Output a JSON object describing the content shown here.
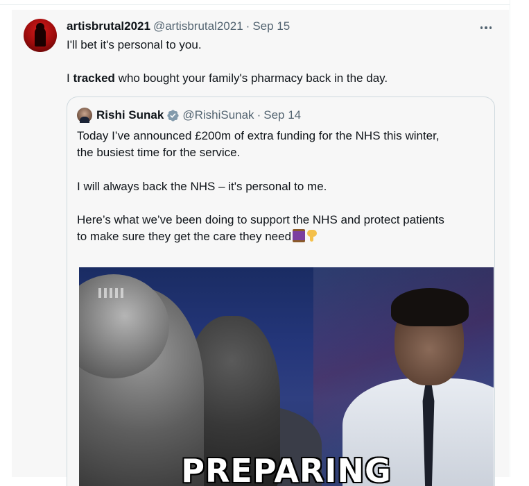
{
  "tweet": {
    "display_name": "artisbrutal2021",
    "handle": "@artisbrutal2021",
    "separator": "·",
    "date": "Sep 15",
    "line1": "I'll bet it's personal to you.",
    "line2_prefix": "I ",
    "line2_bold": "tracked",
    "line2_suffix": " who bought your family's pharmacy back in the day."
  },
  "quote": {
    "display_name": "Rishi Sunak",
    "handle": "@RishiSunak",
    "separator": "·",
    "date": "Sep 14",
    "verified": true,
    "lines": [
      "Today I’ve announced £200m of extra funding for the NHS this winter,",
      "the busiest time for the service.",
      "I will always back the NHS – it's personal to me.",
      "Here’s what we’ve been doing to support the NHS and protect patients",
      "to make sure they get the care they need"
    ],
    "emojis": [
      "thread-icon",
      "pointing-down-icon"
    ],
    "media_caption": "PREPARING"
  },
  "colors": {
    "text": "#0f1419",
    "muted": "#536471",
    "verified": "#829aab",
    "border": "#cfd9de"
  }
}
